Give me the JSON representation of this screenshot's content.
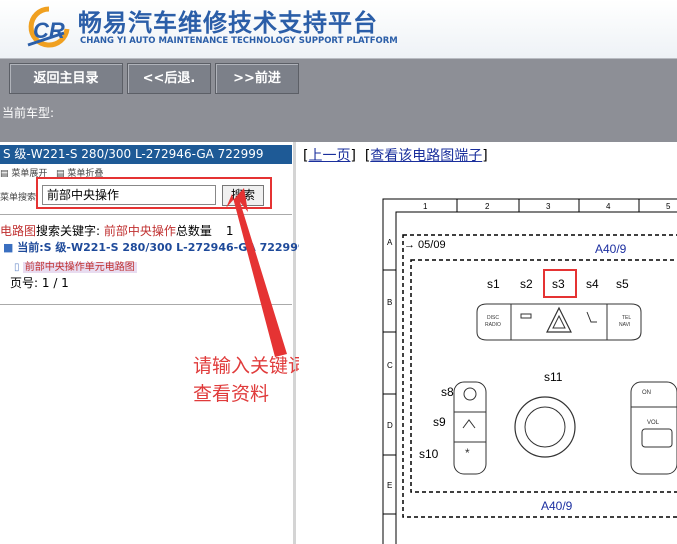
{
  "header": {
    "title_cn": "畅易汽车维修技术支持平台",
    "title_en": "CHANG YI AUTO MAINTENANCE TECHNOLOGY SUPPORT PLATFORM",
    "logo_icon": "cr-logo-icon"
  },
  "toolbar": {
    "back_home": "返回主目录",
    "back": "<<后退.",
    "forward": ">>前进"
  },
  "car_type_label": "当前车型:",
  "left": {
    "model": "S 级-W221-S 280/300 L-272946-GA 722999",
    "menu_expand": "菜单展开",
    "menu_collapse": "菜单折叠",
    "search_label": "菜单搜索",
    "search_value": "前部中央操作",
    "search_button": "搜索",
    "result_prefix": "电路图",
    "result_mid": "搜索关键字:",
    "result_keyword": "前部中央操作",
    "result_total_label": "总数量",
    "result_total_value": "1",
    "tree_root": "当前:S 级-W221-S 280/300 L-272946-GA 722999",
    "tree_child": "前部中央操作单元电路图",
    "page_label": "页号:",
    "page_value": "1 / 1",
    "annotation_line1": "请输入关键词搜索",
    "annotation_line2": "查看资料"
  },
  "right": {
    "prev_link": "上一页",
    "terminal_link": "查看该电路图端子",
    "diagram": {
      "col_labels": [
        "1",
        "2",
        "3",
        "4",
        "5"
      ],
      "row_labels": [
        "A",
        "B",
        "C",
        "D",
        "E"
      ],
      "date": "→ 05/09",
      "component_top": "A40/9",
      "component_bottom": "A40/9",
      "switches": [
        "s1",
        "s2",
        "s3",
        "s4",
        "s5",
        "s8",
        "s9",
        "s10",
        "s11"
      ],
      "disc_label": "DISC",
      "radio_label": "RADIO",
      "tel_label": "TEL",
      "navi_label": "NAVI",
      "on_label": "ON",
      "vol_label": "VOL",
      "s_partial": "s"
    }
  }
}
